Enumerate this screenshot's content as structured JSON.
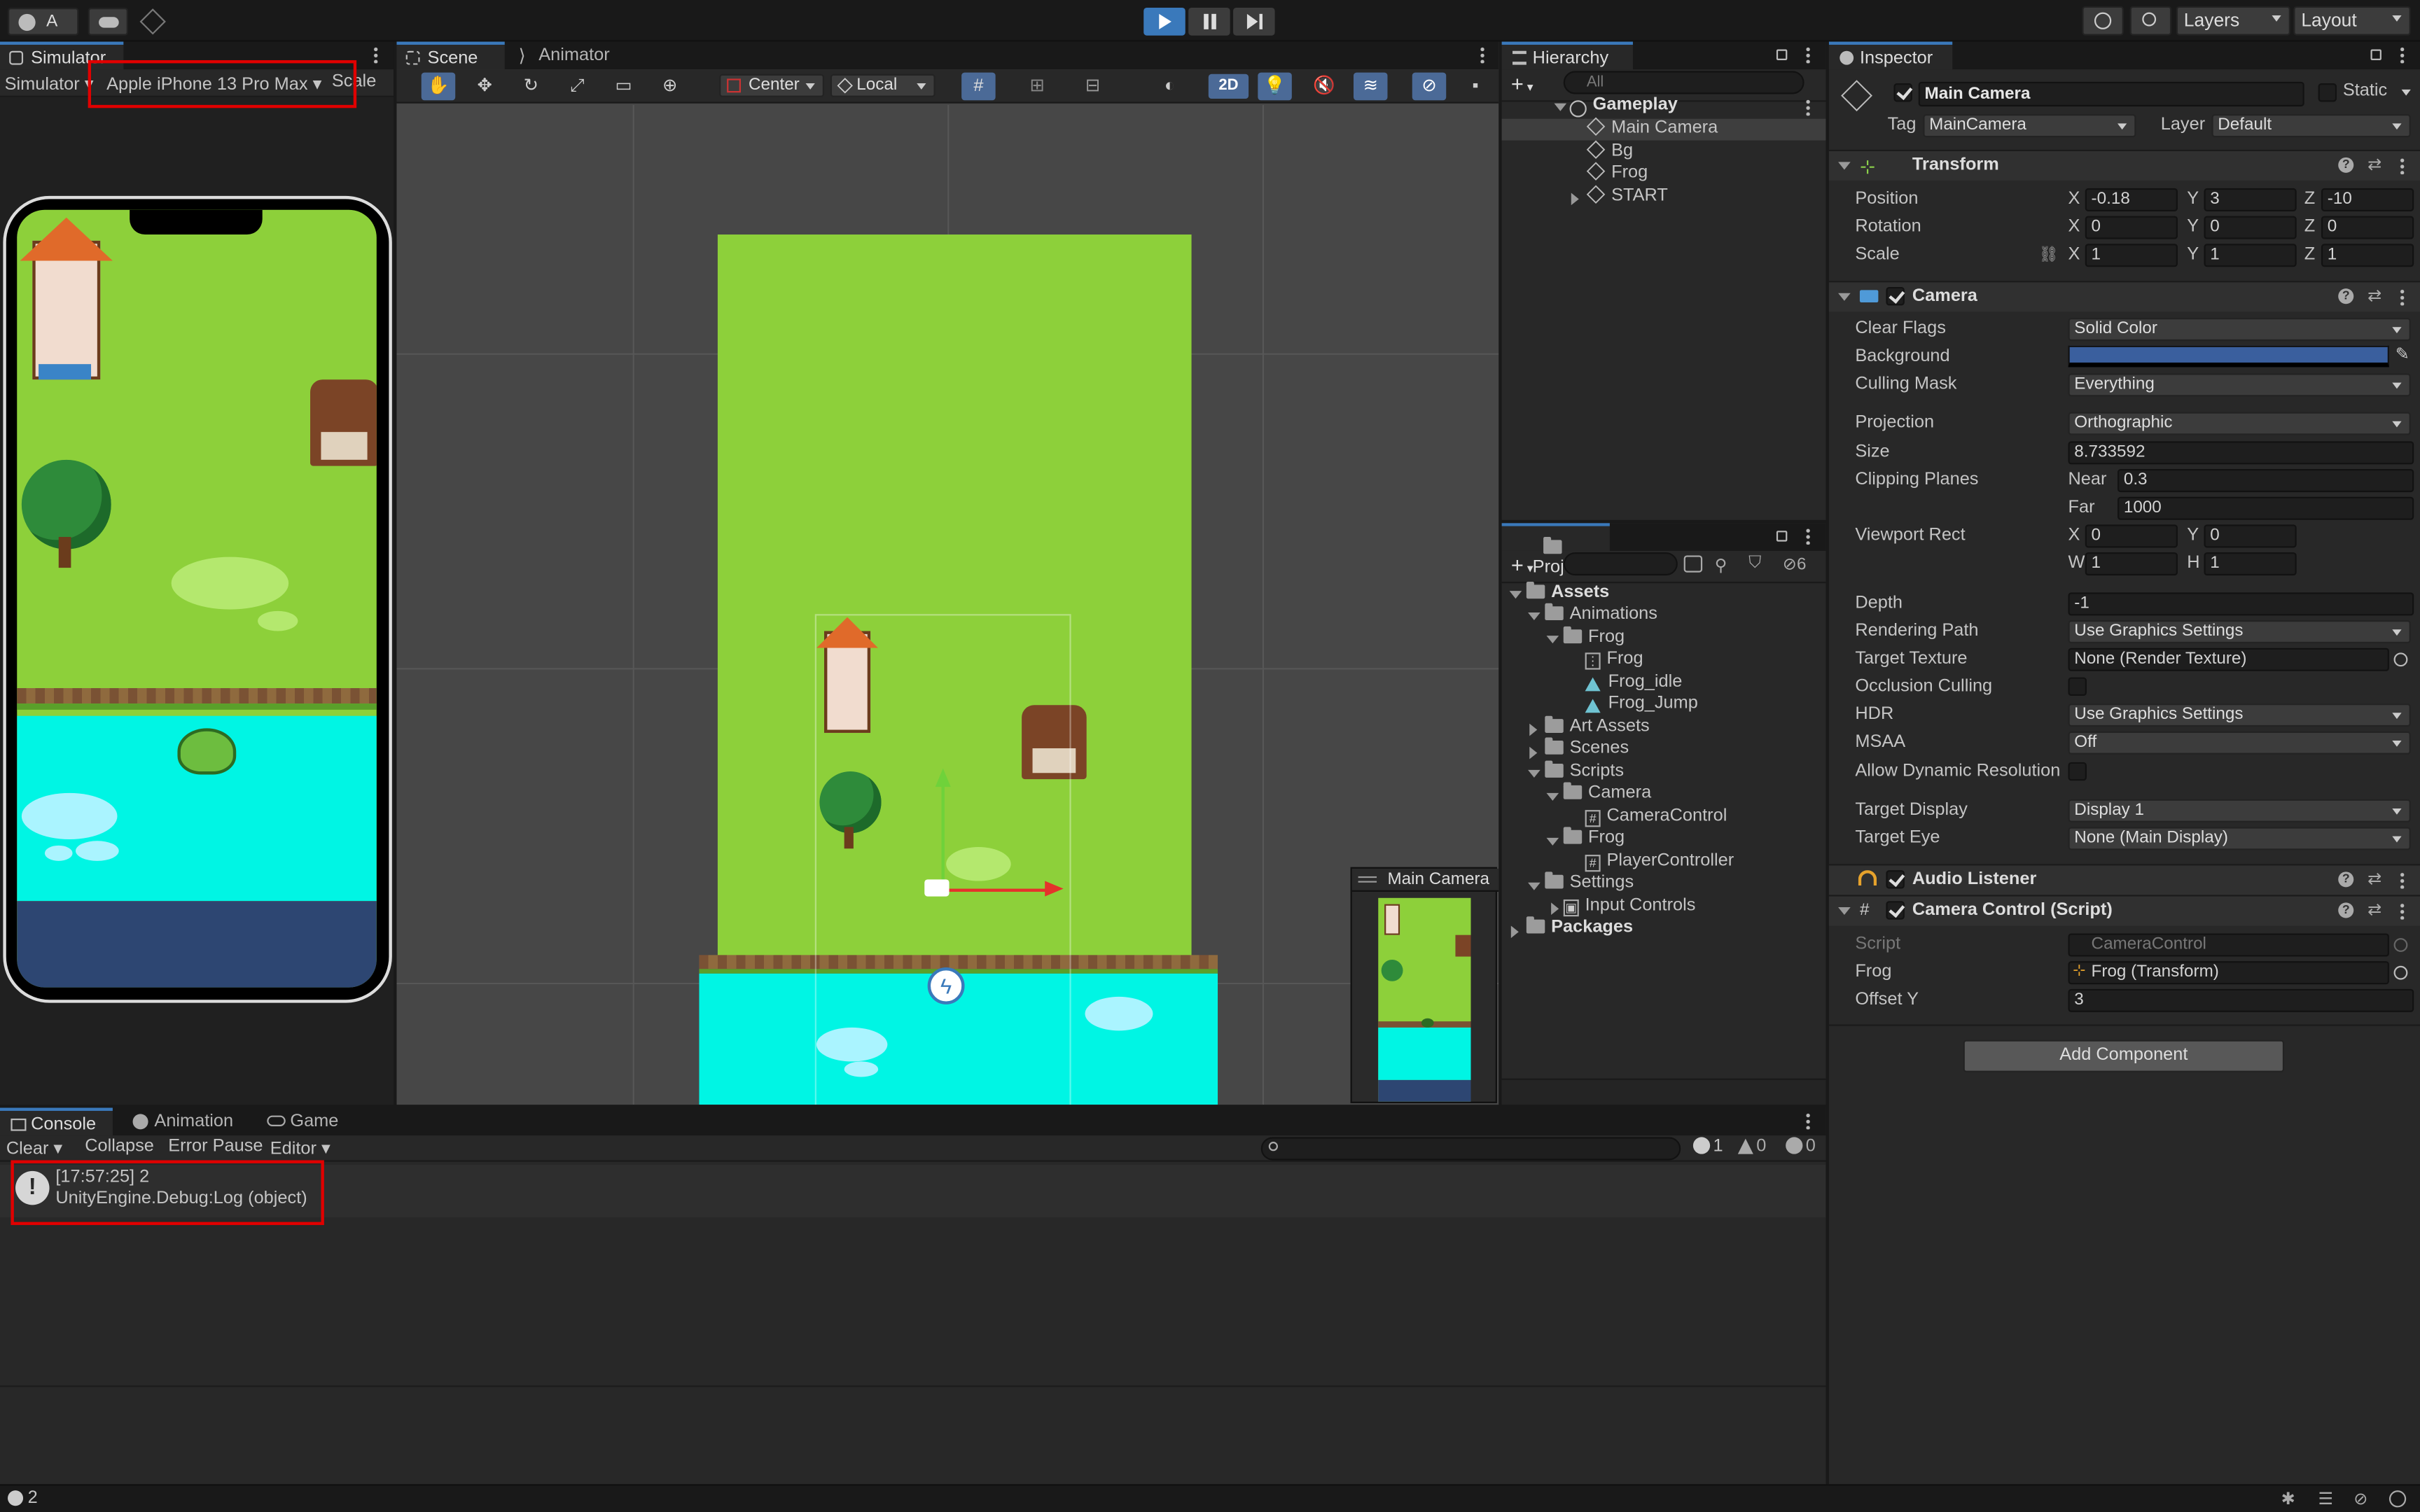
{
  "toolbar": {
    "account": "A",
    "layers": "Layers",
    "layout": "Layout"
  },
  "simulator": {
    "tab": "Simulator",
    "mode": "Simulator",
    "device": "Apple iPhone 13 Pro Max",
    "scale": "Scale"
  },
  "scene": {
    "tab_scene": "Scene",
    "tab_animator": "Animator",
    "pivot": "Center",
    "space": "Local",
    "mode2d": "2D",
    "camera_preview": "Main Camera"
  },
  "hierarchy": {
    "tab": "Hierarchy",
    "search_placeholder": "All",
    "items": [
      "Gameplay",
      "Main Camera",
      "Bg",
      "Frog",
      "START"
    ]
  },
  "project": {
    "tab": "Project",
    "hidden_count": "6",
    "items": [
      "Assets",
      "Animations",
      "Frog",
      "Frog",
      "Frog_idle",
      "Frog_Jump",
      "Art Assets",
      "Scenes",
      "Scripts",
      "Camera",
      "CameraControl",
      "Frog",
      "PlayerController",
      "Settings",
      "Input Controls",
      "Packages"
    ]
  },
  "inspector": {
    "tab": "Inspector",
    "object_name": "Main Camera",
    "static": "Static",
    "tag_label": "Tag",
    "tag": "MainCamera",
    "layer_label": "Layer",
    "layer": "Default",
    "transform": {
      "title": "Transform",
      "position_label": "Position",
      "position": [
        "-0.18",
        "3",
        "-10"
      ],
      "rotation_label": "Rotation",
      "rotation": [
        "0",
        "0",
        "0"
      ],
      "scale_label": "Scale",
      "scale": [
        "1",
        "1",
        "1"
      ]
    },
    "axes": [
      "X",
      "Y",
      "Z"
    ],
    "camera": {
      "title": "Camera",
      "clear_flags_label": "Clear Flags",
      "clear_flags": "Solid Color",
      "background_label": "Background",
      "background_color": "#3a5f9e",
      "culling_mask_label": "Culling Mask",
      "culling_mask": "Everything",
      "projection_label": "Projection",
      "projection": "Orthographic",
      "size_label": "Size",
      "size": "8.733592",
      "clipping_label": "Clipping Planes",
      "near_label": "Near",
      "near": "0.3",
      "far_label": "Far",
      "far": "1000",
      "viewport_label": "Viewport Rect",
      "vx": "0",
      "vy": "0",
      "vw": "1",
      "vh": "1",
      "x": "X",
      "y": "Y",
      "w": "W",
      "h": "H",
      "depth_label": "Depth",
      "depth": "-1",
      "rendering_path_label": "Rendering Path",
      "rendering_path": "Use Graphics Settings",
      "target_texture_label": "Target Texture",
      "target_texture": "None (Render Texture)",
      "occlusion_label": "Occlusion Culling",
      "hdr_label": "HDR",
      "hdr": "Use Graphics Settings",
      "msaa_label": "MSAA",
      "msaa": "Off",
      "dyn_res_label": "Allow Dynamic Resolution",
      "target_display_label": "Target Display",
      "target_display": "Display 1",
      "target_eye_label": "Target Eye",
      "target_eye": "None (Main Display)"
    },
    "audio_listener": "Audio Listener",
    "camera_control": {
      "title": "Camera Control (Script)",
      "script_label": "Script",
      "script": "CameraControl",
      "frog_label": "Frog",
      "frog": "Frog (Transform)",
      "offset_label": "Offset Y",
      "offset": "3"
    },
    "add_component": "Add Component"
  },
  "console": {
    "tab_console": "Console",
    "tab_animation": "Animation",
    "tab_game": "Game",
    "clear": "Clear",
    "collapse": "Collapse",
    "error_pause": "Error Pause",
    "editor": "Editor",
    "log_count": "1",
    "warn_count": "0",
    "error_count": "0",
    "entry_line1": "[17:57:25] 2",
    "entry_line2": "UnityEngine.Debug:Log (object)"
  },
  "status": {
    "message_count": "2"
  },
  "colors": {
    "accent": "#3a79bb",
    "highlight": "#e00000",
    "grass": "#8dd03a",
    "water": "#00f5e4",
    "deep": "#2d4672"
  }
}
